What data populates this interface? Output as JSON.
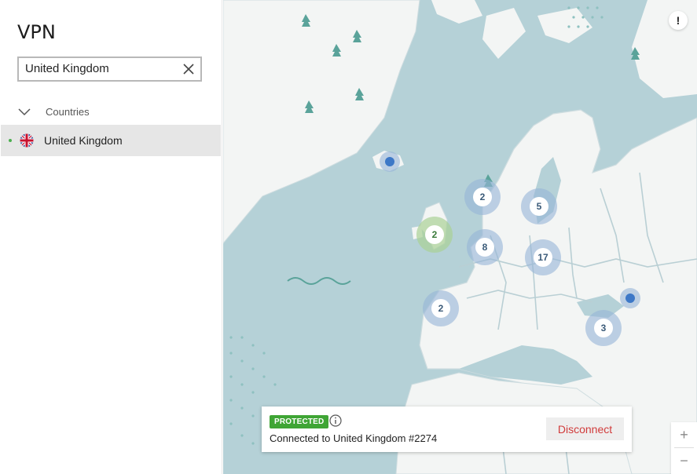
{
  "app": {
    "title": "VPN"
  },
  "search": {
    "value": "United Kingdom",
    "clear_icon": "close-icon"
  },
  "sidebar": {
    "section_label": "Countries",
    "items": [
      {
        "label": "United Kingdom",
        "icon": "uk-flag-icon",
        "status": "connected"
      }
    ]
  },
  "map": {
    "clusters": [
      {
        "count": "2",
        "region": "uk",
        "state": "active"
      },
      {
        "count": "2",
        "region": "norway"
      },
      {
        "count": "5",
        "region": "sweden-finland"
      },
      {
        "count": "8",
        "region": "benelux"
      },
      {
        "count": "17",
        "region": "central-europe"
      },
      {
        "count": "2",
        "region": "iberia"
      },
      {
        "count": "3",
        "region": "turkey"
      }
    ],
    "pins": [
      "iceland",
      "georgia"
    ]
  },
  "status": {
    "badge": "PROTECTED",
    "connection": "Connected to United Kingdom #2274",
    "disconnect_label": "Disconnect"
  },
  "zoom": {
    "in": "+",
    "out": "−"
  },
  "alert": {
    "label": "!"
  },
  "colors": {
    "protected": "#3fa535",
    "disconnect": "#d13b3b",
    "pin": "#3d78c7",
    "water": "#b5d1d7",
    "land": "#f3f5f4"
  }
}
